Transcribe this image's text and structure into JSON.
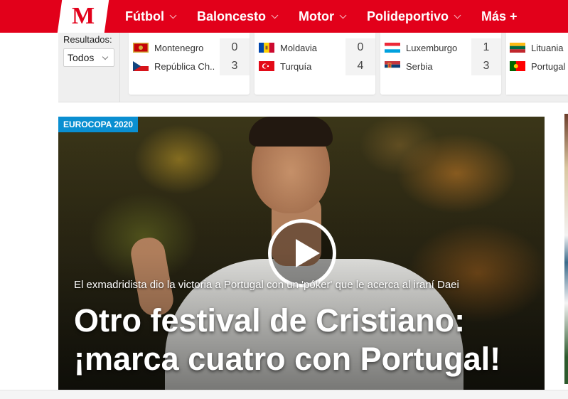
{
  "header": {
    "logo_text": "M",
    "nav": [
      {
        "label": "Fútbol"
      },
      {
        "label": "Baloncesto"
      },
      {
        "label": "Motor"
      },
      {
        "label": "Polideportivo"
      }
    ],
    "more_label": "Más +",
    "accent_color": "#e2001a"
  },
  "results": {
    "label": "Resultados:",
    "filter_value": "Todos",
    "matches": [
      {
        "home": {
          "name": "Montenegro",
          "score": "0",
          "flag": "montenegro-flag"
        },
        "away": {
          "name": "República Ch...",
          "score": "3",
          "flag": "czech-flag"
        }
      },
      {
        "home": {
          "name": "Moldavia",
          "score": "0",
          "flag": "moldova-flag"
        },
        "away": {
          "name": "Turquía",
          "score": "4",
          "flag": "turkey-flag"
        }
      },
      {
        "home": {
          "name": "Luxemburgo",
          "score": "1",
          "flag": "luxembourg-flag"
        },
        "away": {
          "name": "Serbia",
          "score": "3",
          "flag": "serbia-flag"
        }
      },
      {
        "home": {
          "name": "Lituania",
          "score": "",
          "flag": "lithuania-flag"
        },
        "away": {
          "name": "Portugal",
          "score": "",
          "flag": "portugal-flag"
        }
      }
    ]
  },
  "hero": {
    "badge": "EUROCOPA 2020",
    "badge_color": "#0a8fd1",
    "subtitle": "El exmadridista dio la victoria a Portugal con un 'póker' que le acerca al iraní Daei",
    "headline": "Otro festival de Cristiano: ¡marca cuatro con Portugal!",
    "play_icon": "play-icon"
  }
}
